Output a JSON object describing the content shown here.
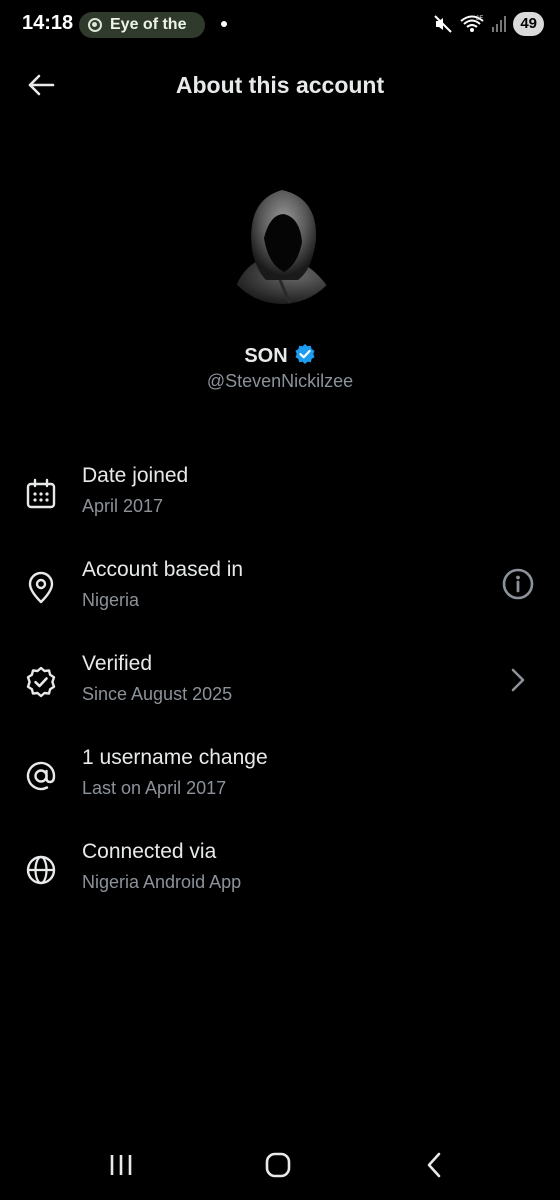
{
  "status_bar": {
    "time": "14:18",
    "media_label": "Eye of the",
    "battery": "49"
  },
  "header": {
    "title": "About this account"
  },
  "profile": {
    "name": "SON",
    "handle": "@StevenNickilzee",
    "verified_color": "#1d9bf0"
  },
  "info": [
    {
      "icon": "calendar-icon",
      "label": "Date joined",
      "sub": "April 2017",
      "action": ""
    },
    {
      "icon": "location-pin-icon",
      "label": "Account based in",
      "sub": "Nigeria",
      "action": "info-icon"
    },
    {
      "icon": "verified-badge-outline-icon",
      "label": "Verified",
      "sub": "Since August 2025",
      "action": "chevron-right-icon"
    },
    {
      "icon": "at-sign-icon",
      "label": "1 username change",
      "sub": "Last on April 2017",
      "action": ""
    },
    {
      "icon": "globe-icon",
      "label": "Connected via",
      "sub": "Nigeria Android App",
      "action": ""
    }
  ],
  "colors": {
    "background": "#000000",
    "text_primary": "#e7e9ea",
    "text_secondary": "#8b9299"
  }
}
